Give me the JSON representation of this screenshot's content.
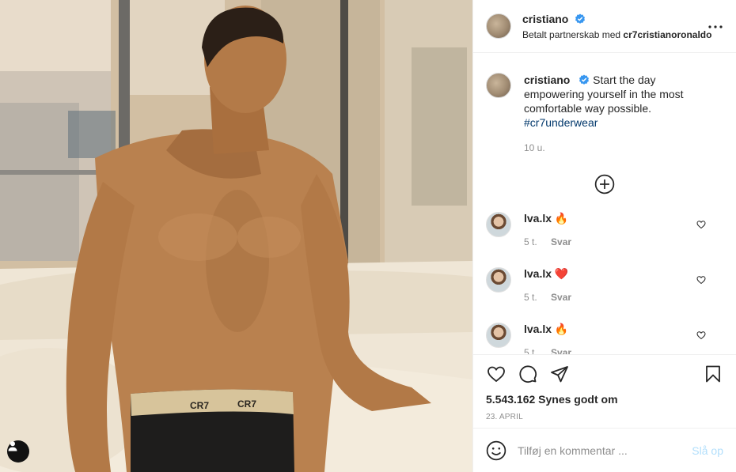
{
  "post": {
    "photo_label": "CR7",
    "author": "cristiano",
    "partnership_prefix": "Betalt partnerskab med",
    "partner": "cr7cristianoronaldo"
  },
  "caption": {
    "username": "cristiano",
    "text": "Start the day empowering yourself in the most comfortable way possible.",
    "hashtag": "#cr7underwear",
    "time": "10 u."
  },
  "comments": [
    {
      "username": "lva.lx",
      "emoji": "🔥",
      "time": "5 t.",
      "reply": "Svar"
    },
    {
      "username": "lva.lx",
      "emoji": "❤️",
      "time": "5 t.",
      "reply": "Svar"
    },
    {
      "username": "lva.lx",
      "emoji": "🔥",
      "time": "5 t.",
      "reply": "Svar"
    }
  ],
  "actions": {
    "likes": "5.543.162 Synes godt om",
    "date": "23. APRIL"
  },
  "add_comment": {
    "placeholder": "Tilføj en kommentar ...",
    "post_label": "Slå op"
  },
  "colors": {
    "link": "#00376b",
    "verified": "#3897f0",
    "muted": "#8e8e8e",
    "post_disabled": "#b2dffc"
  }
}
